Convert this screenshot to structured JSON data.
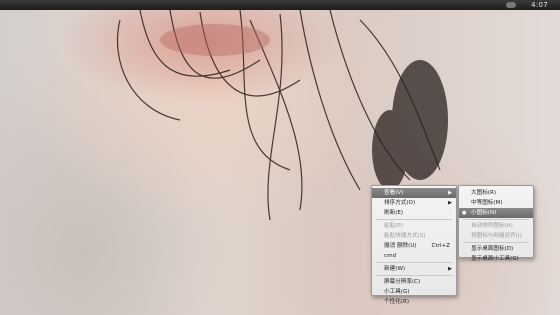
{
  "panel": {
    "clock": "4:07"
  },
  "main_menu": [
    {
      "label": "查看(V)",
      "submenu": true,
      "highlight": true
    },
    {
      "label": "排序方式(O)",
      "submenu": true
    },
    {
      "label": "刷新(E)"
    },
    {
      "separator": true
    },
    {
      "label": "粘贴(P)",
      "disabled": true
    },
    {
      "label": "粘贴快捷方式(S)",
      "disabled": true
    },
    {
      "label": "撤消 删除(U)",
      "shortcut": "Ctrl+Z"
    },
    {
      "label": "cmd"
    },
    {
      "separator": true
    },
    {
      "label": "新建(W)",
      "submenu": true
    },
    {
      "separator": true
    },
    {
      "label": "屏幕分辨率(C)"
    },
    {
      "label": "小工具(G)"
    },
    {
      "label": "个性化(R)"
    }
  ],
  "sub_menu": [
    {
      "label": "大图标(R)"
    },
    {
      "label": "中等图标(M)"
    },
    {
      "label": "小图标(N)",
      "checked": true,
      "highlight": true
    },
    {
      "separator": true
    },
    {
      "label": "自动排列图标(A)",
      "disabled": true
    },
    {
      "label": "将图标与网格对齐(I)",
      "disabled": true
    },
    {
      "separator": true
    },
    {
      "label": "显示桌面图标(D)"
    },
    {
      "label": "显示桌面小工具(G)"
    }
  ],
  "icons": {
    "submenu_arrow": "triangle-right-icon",
    "check": "bullet-check-icon",
    "tray": "network-icon"
  }
}
